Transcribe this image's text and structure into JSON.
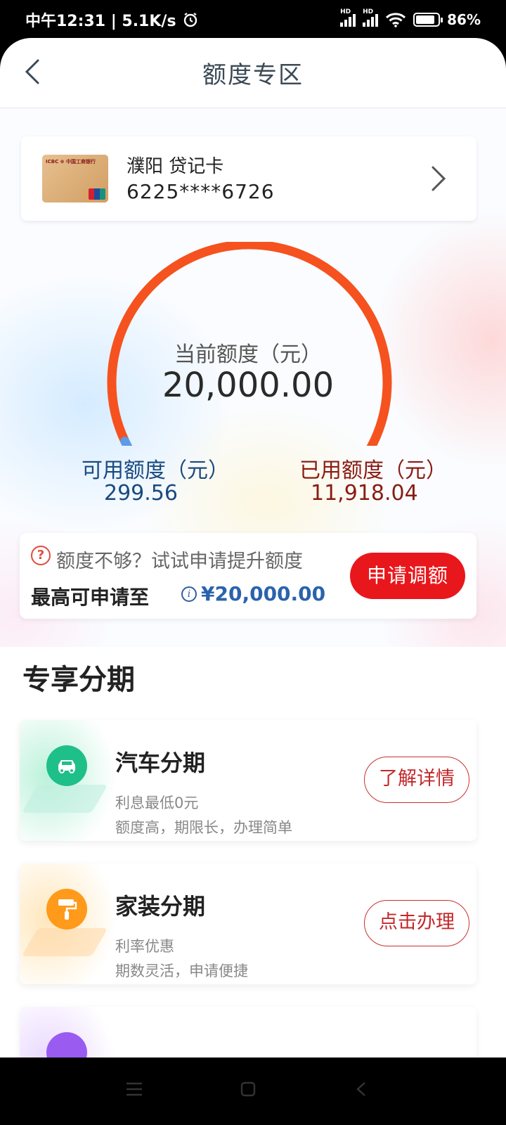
{
  "status_bar": {
    "time": "中午12:31 | 5.1K/s",
    "battery": "86%"
  },
  "header": {
    "title": "额度专区"
  },
  "card": {
    "name": "濮阳 贷记卡",
    "number": "6225****6726"
  },
  "credit": {
    "current_label": "当前额度（元）",
    "current_value": "20,000.00",
    "available_label": "可用额度（元）",
    "available_value": "299.56",
    "used_label": "已用额度（元）",
    "used_value": "11,918.04",
    "gauge_used_fraction": 0.98
  },
  "raise": {
    "prompt": "额度不够？试试申请提升额度",
    "max_label": "最高可申请至",
    "max_value": "¥20,000.00",
    "button": "申请调额"
  },
  "section": {
    "title": "专享分期"
  },
  "products": [
    {
      "title": "汽车分期",
      "line1": "利息最低0元",
      "line2": "额度高，期限长，办理简单",
      "button": "了解详情",
      "color": "#1fbf8a",
      "icon": "car-icon"
    },
    {
      "title": "家装分期",
      "line1": "利率优惠",
      "line2": "期数灵活，申请便捷",
      "button": "点击办理",
      "color": "#ff9a1a",
      "icon": "paint-roller-icon"
    },
    {
      "color": "#9a5cf0",
      "icon": "purple-product-icon"
    }
  ],
  "colors": {
    "gauge_used": "#f5521f",
    "gauge_available": "#5b9be8",
    "apply_button": "#e8171c"
  }
}
